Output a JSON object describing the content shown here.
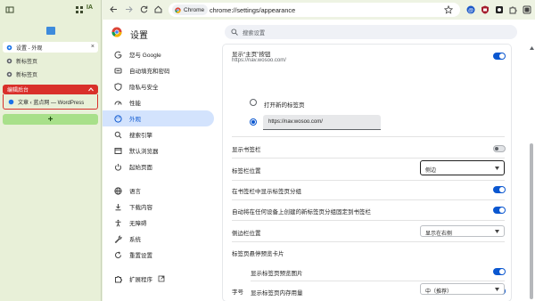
{
  "vertical_tabs": {
    "ia_label": "IA",
    "tabs": [
      {
        "title": "设置 - 外观",
        "active": true
      },
      {
        "title": "新标签页",
        "active": false
      },
      {
        "title": "新标签页",
        "active": false
      }
    ],
    "group": {
      "name": "编辑后台",
      "color": "#d9302a",
      "tab_title": "文章 ‹ 蓝点网 — WordPress"
    },
    "new_tab_label": "+"
  },
  "toolbar": {
    "chip_label": "Chrome",
    "url": "chrome://settings/appearance"
  },
  "settings": {
    "title": "设置",
    "search_placeholder": "搜索设置",
    "nav": [
      {
        "label": "您与 Google",
        "icon": "google-icon"
      },
      {
        "label": "自动填充和密码",
        "icon": "autofill-icon"
      },
      {
        "label": "隐私与安全",
        "icon": "shield-icon"
      },
      {
        "label": "性能",
        "icon": "performance-icon"
      },
      {
        "label": "外观",
        "icon": "palette-icon",
        "selected": true
      },
      {
        "label": "搜索引擎",
        "icon": "search-icon"
      },
      {
        "label": "默认浏览器",
        "icon": "browser-icon"
      },
      {
        "label": "起始页面",
        "icon": "power-icon"
      },
      {
        "label": "语言",
        "icon": "language-icon"
      },
      {
        "label": "下载内容",
        "icon": "download-icon"
      },
      {
        "label": "无障碍",
        "icon": "accessibility-icon"
      },
      {
        "label": "系统",
        "icon": "wrench-icon"
      },
      {
        "label": "重置设置",
        "icon": "reset-icon"
      }
    ],
    "extensions_label": "扩展程序",
    "appearance": {
      "home_button_label": "显示“主页”按钮",
      "home_button_url": "https://nav.wosoo.com/",
      "home_button_on": true,
      "radio_new_tab": "打开新的标签页",
      "radio_custom_url": "https://nav.wosoo.com/",
      "show_bookmarks_bar": "显示书签栏",
      "show_bookmarks_bar_on": false,
      "tab_strip_position_label": "标签栏位置",
      "tab_strip_position_value": "侧边",
      "show_groups_label": "在书签栏中显示标签页分组",
      "show_groups_on": true,
      "pin_groups_label": "自动将在任何设备上创建的新标签页分组固定到书签栏",
      "pin_groups_on": true,
      "side_panel_label": "侧边栏位置",
      "side_panel_value": "显示在右侧",
      "hover_card_label": "标签页悬停预览卡片",
      "hover_image_label": "显示标签页预览图片",
      "hover_image_on": true,
      "hover_memory_label": "显示标签页内存用量",
      "hover_memory_on": true,
      "font_size_label": "字号",
      "font_size_value": "中（推荐）"
    }
  },
  "colors": {
    "accent": "#0b57d0",
    "nav_selected_bg": "#d3e3fd",
    "tabs_panel_bg": "#e8f0d8",
    "group_red": "#d9302a",
    "new_tab_green": "#a8e08a"
  }
}
